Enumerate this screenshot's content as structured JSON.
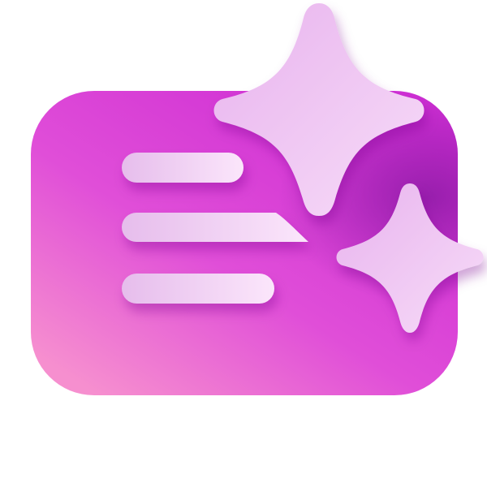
{
  "icon": {
    "name": "ai-sparkle-notes-icon",
    "colors": {
      "card_top_left": "#d22fd6",
      "card_mid": "#d43be0",
      "card_bottom_left": "#f38ccd",
      "card_right_shadow": "#9b1cab",
      "line_fill_start": "#e9c0ee",
      "line_fill_end": "#fbe4fb",
      "sparkle_fill_start": "#e9b7ee",
      "sparkle_fill_end": "#f6d8f7"
    }
  }
}
